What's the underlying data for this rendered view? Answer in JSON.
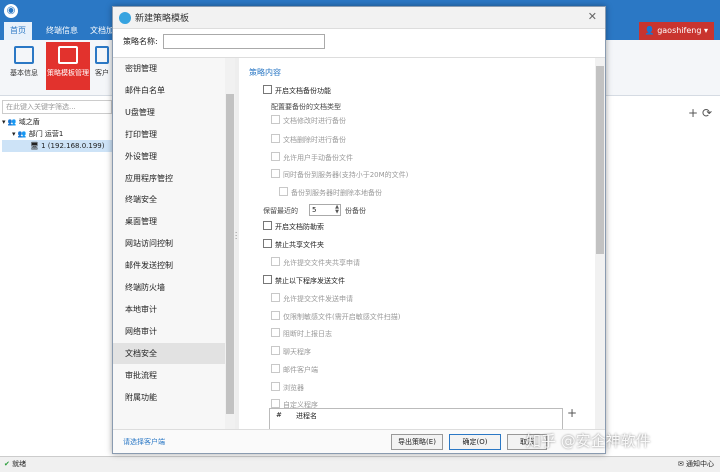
{
  "app": {
    "menu_tabs": [
      "首页",
      "终端信息",
      "文档加"
    ],
    "user": "gaoshifeng",
    "ribbon": [
      "基本信息",
      "策略模板管理",
      "客户"
    ],
    "search_placeholder": "在此键入关键字筛选...",
    "tree": [
      "域之盾",
      "部门 运营1",
      "1 (192.168.0.199)"
    ],
    "status_left": "就绪",
    "status_right": "通知中心"
  },
  "dialog": {
    "title": "新建策略模板",
    "name_label": "策略名称:",
    "name_value": "",
    "nav_items": [
      "密钥管理",
      "邮件白名单",
      "U盘管理",
      "打印管理",
      "外设管理",
      "应用程序管控",
      "终端安全",
      "桌面管理",
      "网站访问控制",
      "邮件发送控制",
      "终端防火墙",
      "本地审计",
      "网络审计",
      "文档安全",
      "审批流程",
      "附属功能"
    ],
    "active_nav": "文档安全",
    "section_title": "策略内容",
    "options": {
      "enable_backup": "开启文档备份功能",
      "backup_types_label": "配置要备份的文档类型",
      "backup_on_modify": "文档修改时进行备份",
      "backup_on_delete": "文档删除时进行备份",
      "allow_manual_backup": "允许用户手动备份文件",
      "sync_to_server": "同时备份到服务器(支持小于20M的文件)",
      "delete_local_after_server": "备份到服务器时删除本地备份",
      "keep_recent_prefix": "保留最近的",
      "keep_recent_value": "5",
      "keep_recent_suffix": "份备份",
      "enable_anti_ransom": "开启文档防勒索",
      "disable_share": "禁止共享文件夹",
      "allow_share_request": "允许提交文件夹共享申请",
      "block_send_programs": "禁止以下程序发送文件",
      "allow_send_request": "允许提交文件发送申请",
      "limit_sensitive": "仅限制敏感文件(需开启敏感文件扫描)",
      "report_log": "阻断时上报日志",
      "chat_programs": "聊天程序",
      "mail_clients": "邮件客户端",
      "browsers": "浏览器",
      "custom_programs": "自定义程序"
    },
    "table_headers": [
      "#",
      "进程名"
    ],
    "footer_link": "请选择客户端",
    "export_button": "导出策略(E)",
    "ok_button": "确定(O)",
    "cancel_button": "取消"
  },
  "watermark": "知乎 @安企神软件"
}
